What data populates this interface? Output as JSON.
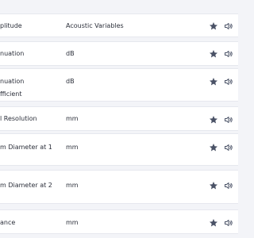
{
  "rows": [
    {
      "name_lines": [
        "plitude"
      ],
      "unit": "Acoustic Variables"
    },
    {
      "name_lines": [
        "nuation"
      ],
      "unit": "dB"
    },
    {
      "name_lines": [
        "nuation",
        "fficient"
      ],
      "unit": "dB"
    },
    {
      "name_lines": [
        "l Resolution"
      ],
      "unit": "mm"
    },
    {
      "name_lines": [
        "m Diameter at 1"
      ],
      "unit": "mm"
    },
    {
      "name_lines": [
        "m Diameter at 2"
      ],
      "unit": "mm"
    },
    {
      "name_lines": [
        "ance"
      ],
      "unit": "mm"
    }
  ],
  "icons": {
    "star": "star-icon",
    "speaker": "speaker-icon"
  },
  "colors": {
    "icon": "#4a5266",
    "row_bg": "#ffffff",
    "page_bg": "#f3f4f8"
  }
}
